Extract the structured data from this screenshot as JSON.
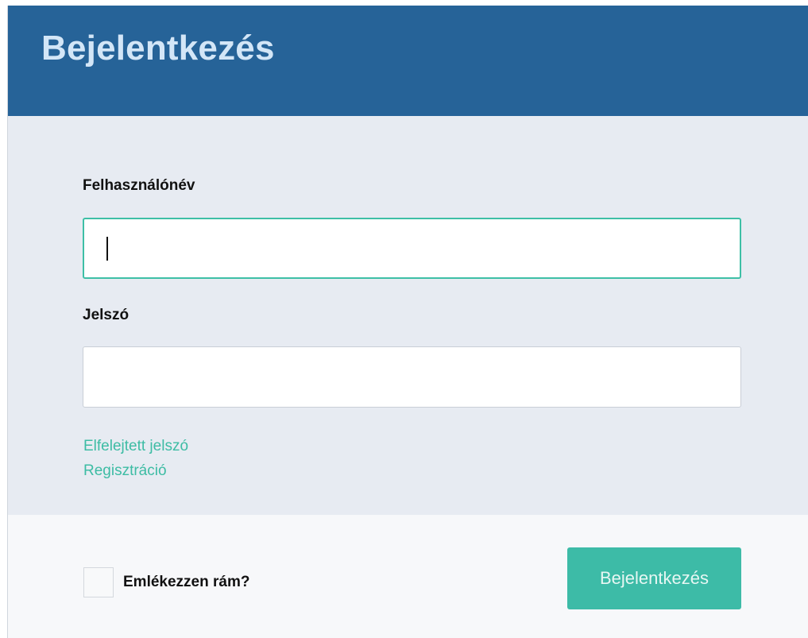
{
  "header": {
    "title": "Bejelentkezés",
    "bg_color": "#266398"
  },
  "form": {
    "username_label": "Felhasználónév",
    "username_value": "",
    "password_label": "Jelszó",
    "password_value": "",
    "forgot_link": "Elfelejtett jelszó",
    "register_link": "Regisztráció",
    "focus_color": "#3ebfa6"
  },
  "footer": {
    "remember_label": "Emlékezzen rám?",
    "remember_checked": false,
    "submit_label": "Bejelentkezés",
    "accent_color": "#3dbba7"
  }
}
